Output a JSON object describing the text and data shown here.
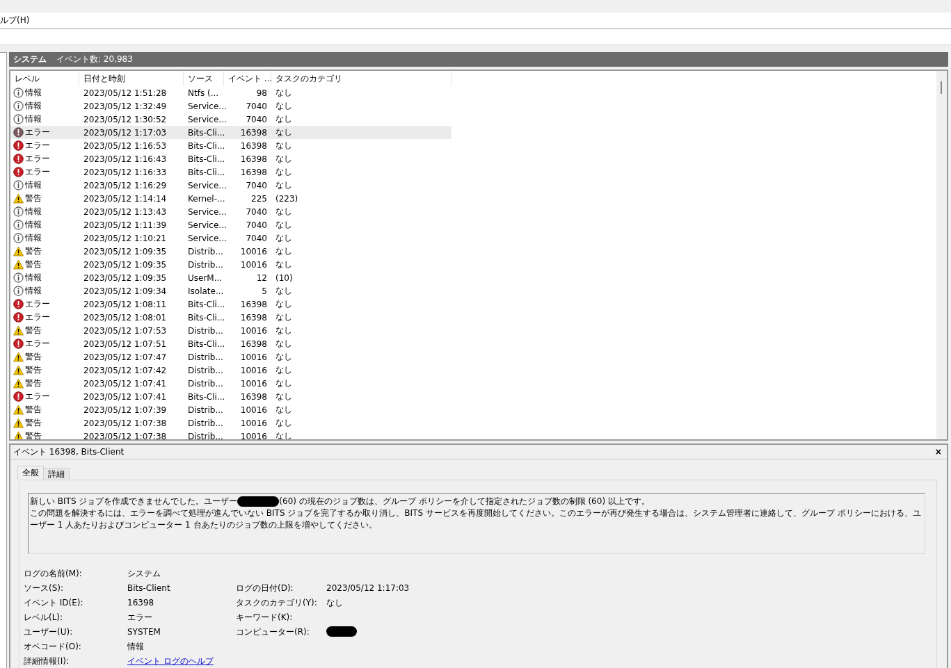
{
  "menu": {
    "items": [
      {
        "label": "ルプ(H)"
      }
    ]
  },
  "log_header": {
    "title": "システム",
    "count": "イベント数: 20,983"
  },
  "table": {
    "columns": [
      "レベル",
      "日付と時刻",
      "ソース",
      "イベント ...",
      "タスクのカテゴリ"
    ],
    "rows": [
      {
        "kind": "info",
        "level": "情報",
        "date": "2023/05/12 1:51:28",
        "source": "Ntfs (...",
        "event_id": "98",
        "category": "なし",
        "selected": false
      },
      {
        "kind": "info",
        "level": "情報",
        "date": "2023/05/12 1:32:49",
        "source": "Service...",
        "event_id": "7040",
        "category": "なし",
        "selected": false
      },
      {
        "kind": "info",
        "level": "情報",
        "date": "2023/05/12 1:30:52",
        "source": "Service...",
        "event_id": "7040",
        "category": "なし",
        "selected": false
      },
      {
        "kind": "error",
        "level": "エラー",
        "date": "2023/05/12 1:17:03",
        "source": "Bits-Cli...",
        "event_id": "16398",
        "category": "なし",
        "selected": true
      },
      {
        "kind": "error",
        "level": "エラー",
        "date": "2023/05/12 1:16:53",
        "source": "Bits-Cli...",
        "event_id": "16398",
        "category": "なし",
        "selected": false
      },
      {
        "kind": "error",
        "level": "エラー",
        "date": "2023/05/12 1:16:43",
        "source": "Bits-Cli...",
        "event_id": "16398",
        "category": "なし",
        "selected": false
      },
      {
        "kind": "error",
        "level": "エラー",
        "date": "2023/05/12 1:16:33",
        "source": "Bits-Cli...",
        "event_id": "16398",
        "category": "なし",
        "selected": false
      },
      {
        "kind": "info",
        "level": "情報",
        "date": "2023/05/12 1:16:29",
        "source": "Service...",
        "event_id": "7040",
        "category": "なし",
        "selected": false
      },
      {
        "kind": "warning",
        "level": "警告",
        "date": "2023/05/12 1:14:14",
        "source": "Kernel-...",
        "event_id": "225",
        "category": "(223)",
        "selected": false
      },
      {
        "kind": "info",
        "level": "情報",
        "date": "2023/05/12 1:13:43",
        "source": "Service...",
        "event_id": "7040",
        "category": "なし",
        "selected": false
      },
      {
        "kind": "info",
        "level": "情報",
        "date": "2023/05/12 1:11:39",
        "source": "Service...",
        "event_id": "7040",
        "category": "なし",
        "selected": false
      },
      {
        "kind": "info",
        "level": "情報",
        "date": "2023/05/12 1:10:21",
        "source": "Service...",
        "event_id": "7040",
        "category": "なし",
        "selected": false
      },
      {
        "kind": "warning",
        "level": "警告",
        "date": "2023/05/12 1:09:35",
        "source": "Distrib...",
        "event_id": "10016",
        "category": "なし",
        "selected": false
      },
      {
        "kind": "warning",
        "level": "警告",
        "date": "2023/05/12 1:09:35",
        "source": "Distrib...",
        "event_id": "10016",
        "category": "なし",
        "selected": false
      },
      {
        "kind": "info",
        "level": "情報",
        "date": "2023/05/12 1:09:35",
        "source": "UserM...",
        "event_id": "12",
        "category": "(10)",
        "selected": false
      },
      {
        "kind": "info",
        "level": "情報",
        "date": "2023/05/12 1:09:34",
        "source": "Isolate...",
        "event_id": "5",
        "category": "なし",
        "selected": false
      },
      {
        "kind": "error",
        "level": "エラー",
        "date": "2023/05/12 1:08:11",
        "source": "Bits-Cli...",
        "event_id": "16398",
        "category": "なし",
        "selected": false
      },
      {
        "kind": "error",
        "level": "エラー",
        "date": "2023/05/12 1:08:01",
        "source": "Bits-Cli...",
        "event_id": "16398",
        "category": "なし",
        "selected": false
      },
      {
        "kind": "warning",
        "level": "警告",
        "date": "2023/05/12 1:07:53",
        "source": "Distrib...",
        "event_id": "10016",
        "category": "なし",
        "selected": false
      },
      {
        "kind": "error",
        "level": "エラー",
        "date": "2023/05/12 1:07:51",
        "source": "Bits-Cli...",
        "event_id": "16398",
        "category": "なし",
        "selected": false
      },
      {
        "kind": "warning",
        "level": "警告",
        "date": "2023/05/12 1:07:47",
        "source": "Distrib...",
        "event_id": "10016",
        "category": "なし",
        "selected": false
      },
      {
        "kind": "warning",
        "level": "警告",
        "date": "2023/05/12 1:07:42",
        "source": "Distrib...",
        "event_id": "10016",
        "category": "なし",
        "selected": false
      },
      {
        "kind": "warning",
        "level": "警告",
        "date": "2023/05/12 1:07:41",
        "source": "Distrib...",
        "event_id": "10016",
        "category": "なし",
        "selected": false
      },
      {
        "kind": "error",
        "level": "エラー",
        "date": "2023/05/12 1:07:41",
        "source": "Bits-Cli...",
        "event_id": "16398",
        "category": "なし",
        "selected": false
      },
      {
        "kind": "warning",
        "level": "警告",
        "date": "2023/05/12 1:07:39",
        "source": "Distrib...",
        "event_id": "10016",
        "category": "なし",
        "selected": false
      },
      {
        "kind": "warning",
        "level": "警告",
        "date": "2023/05/12 1:07:38",
        "source": "Distrib...",
        "event_id": "10016",
        "category": "なし",
        "selected": false
      },
      {
        "kind": "warning",
        "level": "警告",
        "date": "2023/05/12 1:07:38",
        "source": "Distrib...",
        "event_id": "10016",
        "category": "なし",
        "selected": false
      }
    ]
  },
  "details": {
    "title": "イベント 16398, Bits-Client",
    "close": "×",
    "tabs": [
      {
        "label": "全般",
        "selected": true
      },
      {
        "label": "詳細",
        "selected": false
      }
    ],
    "message": [
      {
        "kind": "text",
        "text": "新しい BITS ジョブを作成できませんでした。ユーザー"
      },
      {
        "kind": "redacted"
      },
      {
        "kind": "text",
        "text": " (60) の現在のジョブ数は、グループ ポリシーを介して指定されたジョブ数の制限 (60) 以上です。"
      }
    ],
    "message_rest": {
      "text": "この問題を解決するには、エラーを調べて処理が進んでいない BITS ジョブを完了するか取り消し、BITS サービスを再度開始してください。このエラーが再び発生する場合は、システム管理者に連絡して、グループ ポリシーにおける、ユーザー 1 人あたりおよびコンピューター 1 台あたりのジョブ数の上限を増やしてください。"
    },
    "fields": [
      {
        "left": {
          "label": "ログの名前(M):",
          "kind": "text",
          "value": "システム"
        }
      },
      {
        "left": {
          "label": "ソース(S):",
          "kind": "text",
          "value": "Bits-Client"
        },
        "right": {
          "label": "ログの日付(D):",
          "kind": "text",
          "value": "2023/05/12 1:17:03"
        }
      },
      {
        "left": {
          "label": "イベント ID(E):",
          "kind": "text",
          "value": "16398"
        },
        "right": {
          "label": "タスクのカテゴリ(Y):",
          "kind": "text",
          "value": "なし"
        }
      },
      {
        "left": {
          "label": "レベル(L):",
          "kind": "text",
          "value": "エラー"
        },
        "right": {
          "label": "キーワード(K):",
          "kind": "empty"
        }
      },
      {
        "left": {
          "label": "ユーザー(U):",
          "kind": "text",
          "value": "SYSTEM"
        },
        "right": {
          "label": "コンピューター(R):",
          "kind": "redacted"
        }
      },
      {
        "left": {
          "label": "オペコード(O):",
          "kind": "text",
          "value": "情報"
        }
      },
      {
        "left": {
          "label": "詳細情報(I):",
          "kind": "link",
          "value": "イベント ログのヘルプ"
        }
      }
    ]
  }
}
